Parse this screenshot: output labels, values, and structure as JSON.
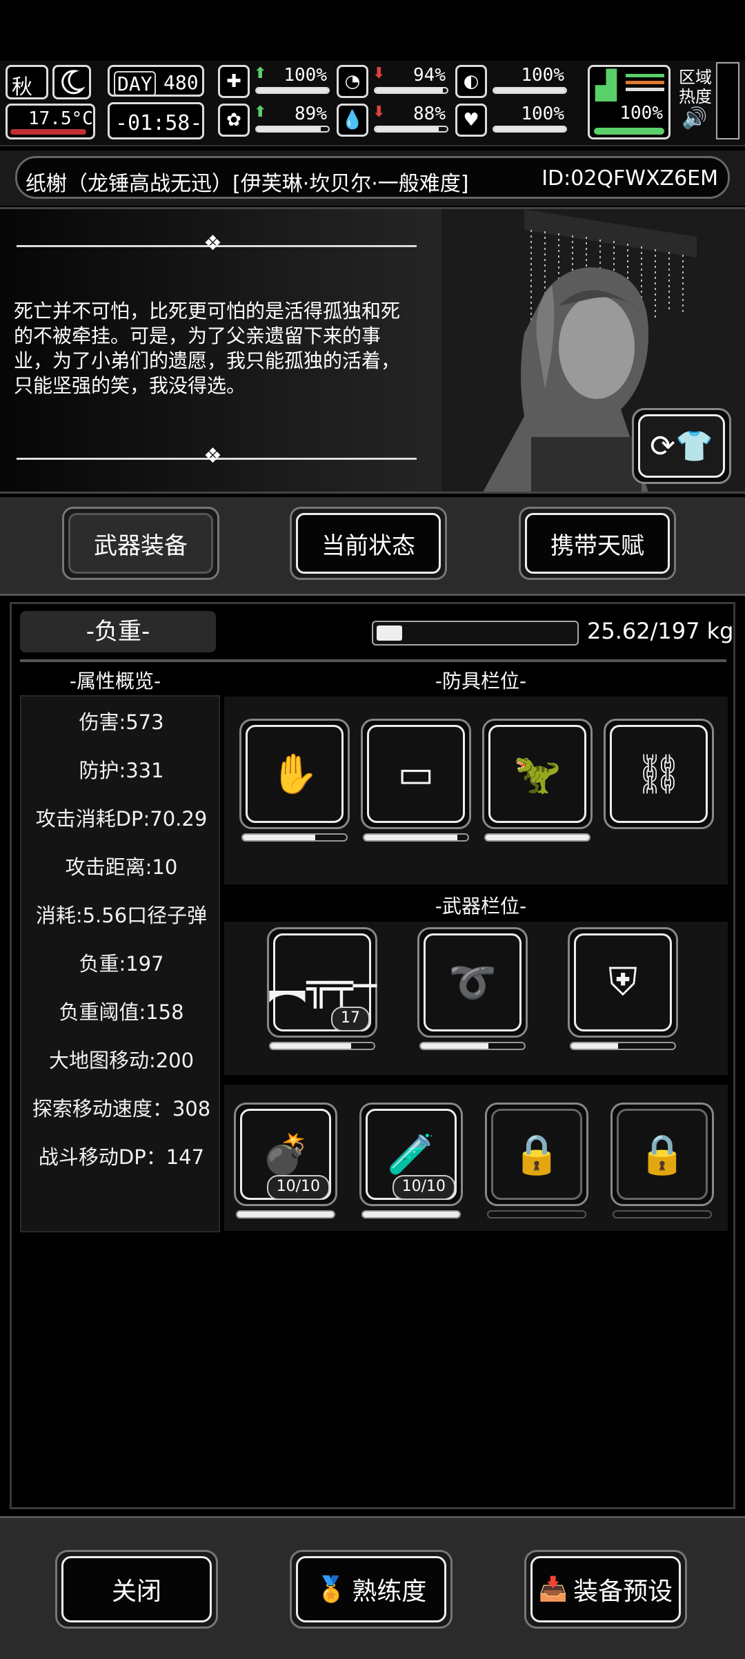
{
  "hud": {
    "season": "秋",
    "temperature": "17.5°C",
    "day_label": "DAY",
    "day": "480",
    "clock": "-01:58-",
    "stats": [
      {
        "icon": "medkit-icon",
        "value": "100%",
        "trend": "up",
        "level": 1.0
      },
      {
        "icon": "stomach-icon",
        "value": "94%",
        "trend": "down",
        "level": 0.94
      },
      {
        "icon": "pill-icon",
        "value": "100%",
        "trend": "none",
        "level": 1.0
      },
      {
        "icon": "brain-icon",
        "value": "89%",
        "trend": "up",
        "level": 0.89
      },
      {
        "icon": "water-drop-icon",
        "value": "88%",
        "trend": "down",
        "level": 0.88
      },
      {
        "icon": "heart-icon",
        "value": "100%",
        "trend": "none",
        "level": 1.0
      }
    ],
    "stamina": "100%",
    "zone_heat_label": "区域热度"
  },
  "character": {
    "title": "纸榭（龙锤高战无迅）[伊芙琳·坎贝尔·一般难度]",
    "id": "ID:02QFWXZ6EM"
  },
  "story": {
    "text": "死亡并不可怕，比死更可怕的是活得孤独和死的不被牵挂。可是，为了父亲遗留下来的事业，为了小弟们的遗愿，我只能孤独的活着，只能坚强的笑，我没得选。"
  },
  "tabs": [
    {
      "label": "武器装备",
      "selected": true
    },
    {
      "label": "当前状态",
      "selected": false
    },
    {
      "label": "携带天赋",
      "selected": false
    }
  ],
  "load": {
    "label": "-负重-",
    "value": "25.62/197 kg",
    "fraction": 0.13
  },
  "attributes": {
    "header": "-属性概览-",
    "items": [
      "伤害:573",
      "防护:331",
      "攻击消耗DP:70.29",
      "攻击距离:10",
      "消耗:5.56口径子弹",
      "负重:197",
      "负重阈值:158",
      "大地图移动:200",
      "探索移动速度：308",
      "战斗移动DP：147"
    ]
  },
  "armor": {
    "header": "-防具栏位-",
    "slots": [
      {
        "icon": "gloves-icon",
        "durability": 0.7
      },
      {
        "icon": "shorts-icon",
        "durability": 0.9
      },
      {
        "icon": "dino-mask-icon",
        "durability": 1.0
      },
      {
        "icon": "backpack-frame-icon",
        "durability": null
      }
    ]
  },
  "weapons": {
    "header": "-武器栏位-",
    "slots": [
      {
        "icon": "assault-rifle-icon",
        "count": "17",
        "durability": 0.78
      },
      {
        "icon": "chain-whip-icon",
        "count": "",
        "durability": 0.65
      },
      {
        "icon": "armor-plate-icon",
        "count": "",
        "durability": 0.45
      }
    ]
  },
  "consumables": {
    "slots": [
      {
        "icon": "grenade-icon",
        "count": "10/10",
        "locked": false,
        "fill": 1.0
      },
      {
        "icon": "canister-icon",
        "count": "10/10",
        "locked": false,
        "fill": 1.0
      },
      {
        "icon": "lock-icon",
        "count": "",
        "locked": true,
        "fill": 0
      },
      {
        "icon": "lock-icon",
        "count": "",
        "locked": true,
        "fill": 0
      }
    ]
  },
  "footer": {
    "close": "关闭",
    "proficiency": "熟练度",
    "preset": "装备预设"
  }
}
